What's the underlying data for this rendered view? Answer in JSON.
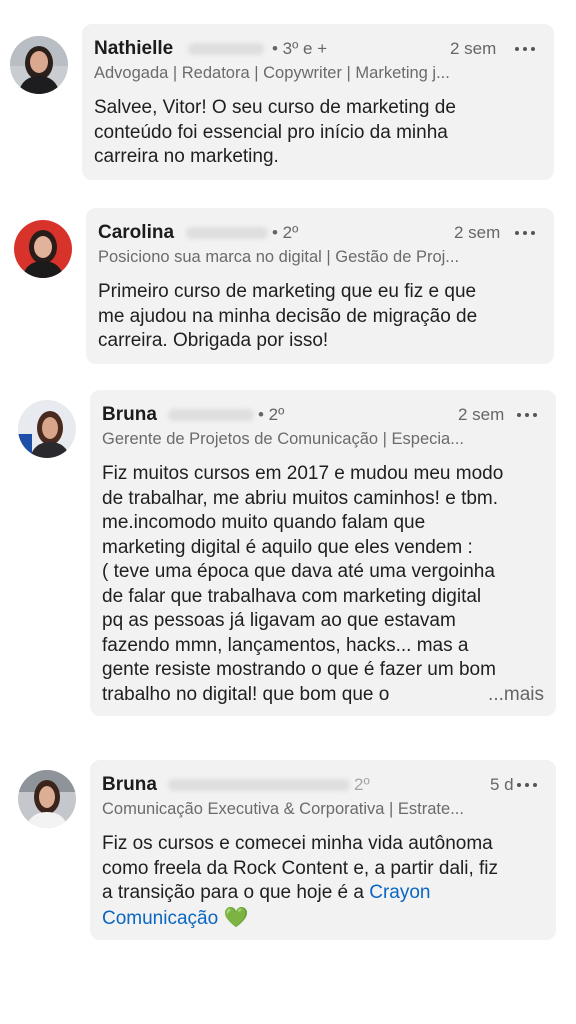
{
  "comments": [
    {
      "name": "Nathielle",
      "degree": "• 3º e +",
      "time": "2 sem",
      "headline": "Advogada | Redatora | Copywriter | Marketing j...",
      "body_lines": [
        "Salvee, Vitor! O seu curso de marketing de",
        "conteúdo foi essencial pro início da minha",
        "carreira no marketing."
      ]
    },
    {
      "name": "Carolina",
      "degree": "• 2º",
      "time": "2 sem",
      "headline": "Posiciono sua marca no digital | Gestão de Proj...",
      "body_lines": [
        "Primeiro curso de marketing que eu fiz e que",
        "me ajudou na minha decisão de migração de",
        "carreira. Obrigada por isso!"
      ]
    },
    {
      "name": "Bruna",
      "degree": "• 2º",
      "time": "2 sem",
      "headline": "Gerente de Projetos de Comunicação | Especia...",
      "body_lines": [
        "Fiz muitos cursos em 2017 e mudou meu modo",
        "de trabalhar, me abriu muitos caminhos! e tbm.",
        "me.incomodo muito quando falam que",
        "marketing digital é aquilo que eles vendem :",
        "(  teve uma época que dava até uma vergoinha",
        "de falar que trabalhava com marketing digital",
        "pq as pessoas já ligavam ao que estavam",
        "fazendo mmn, lançamentos, hacks... mas a",
        "gente resiste mostrando o que é fazer um bom",
        "trabalho no digital! que bom que o"
      ],
      "more_label": "...mais"
    },
    {
      "name": "Bruna",
      "degree": "2º",
      "time": "5 d",
      "headline": "Comunicação Executiva & Corporativa | Estrate...",
      "body_lines": [
        "Fiz os cursos e comecei minha vida autônoma",
        "como freela da Rock Content e, a partir dali, fiz",
        "a transição para o que hoje é a"
      ],
      "link_part1": "Crayon",
      "link_part2": "Comunicação",
      "emoji": "💚"
    }
  ],
  "icons": {
    "more": "more-horizontal-icon"
  },
  "colors": {
    "bubble": "#f2f2f2",
    "link": "#0a66c2",
    "meta": "#666666"
  }
}
